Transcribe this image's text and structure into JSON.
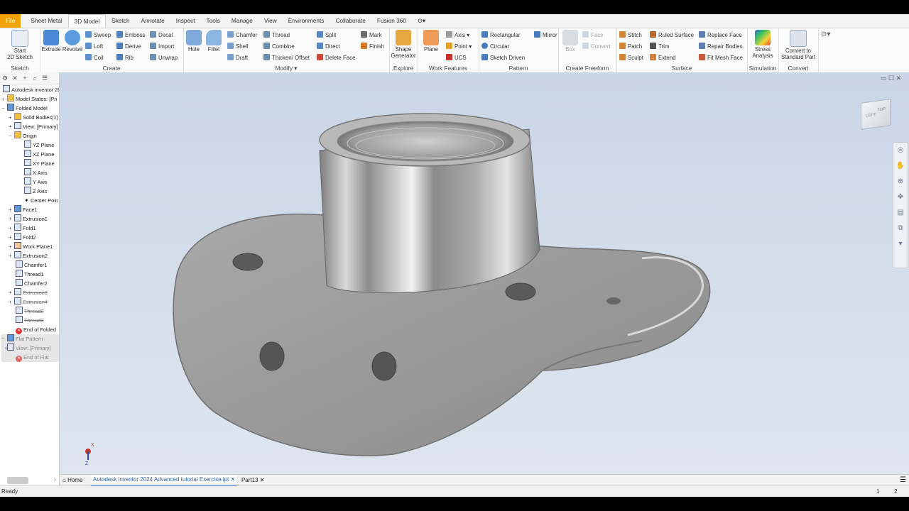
{
  "tabs": [
    "File",
    "Sheet Metal",
    "3D Model",
    "Sketch",
    "Annotate",
    "Inspect",
    "Tools",
    "Manage",
    "View",
    "Environments",
    "Collaborate",
    "Fusion 360"
  ],
  "ribbon": {
    "sketch": {
      "start_line1": "Start",
      "start_line2": "2D Sketch",
      "label": "Sketch"
    },
    "create": {
      "extrude": "Extrude",
      "revolve": "Revolve",
      "sweep": "Sweep",
      "loft": "Loft",
      "coil": "Coil",
      "emboss": "Emboss",
      "derive": "Derive",
      "rib": "Rib",
      "decal": "Decal",
      "import": "Import",
      "unwrap": "Unwrap",
      "label": "Create"
    },
    "modify": {
      "hole": "Hole",
      "fillet": "Fillet",
      "chamfer": "Chamfer",
      "shell": "Shell",
      "draft": "Draft",
      "thread": "Thread",
      "combine": "Combine",
      "thicken": "Thicken/ Offset",
      "split": "Split",
      "direct": "Direct",
      "delete_face": "Delete Face",
      "mark": "Mark",
      "finish": "Finish",
      "label": "Modify"
    },
    "explore": {
      "shape1": "Shape",
      "shape2": "Generator",
      "label": "Explore"
    },
    "work": {
      "plane": "Plane",
      "axis": "Axis",
      "point": "Point",
      "ucs": "UCS",
      "label": "Work Features"
    },
    "pattern": {
      "rectangular": "Rectangular",
      "circular": "Circular",
      "sketch_driven": "Sketch Driven",
      "mirror": "Mirror",
      "label": "Pattern"
    },
    "freeform": {
      "box": "Box",
      "face": "Face",
      "convert": "Convert",
      "label": "Create Freeform"
    },
    "surface": {
      "stitch": "Stitch",
      "patch": "Patch",
      "sculpt": "Sculpt",
      "ruled": "Ruled Surface",
      "trim": "Trim",
      "extend": "Extend",
      "replace": "Replace Face",
      "repair": "Repair Bodies",
      "fitmesh": "Fit Mesh Face",
      "label": "Surface"
    },
    "simulation": {
      "stress1": "Stress",
      "stress2": "Analysis",
      "label": "Simulation"
    },
    "convert": {
      "c1": "Convert to",
      "c2": "Standard Part",
      "label": "Convert"
    }
  },
  "browser": {
    "root": "Autodesk inventor 20",
    "model_states": "Model States: [Pri",
    "folded": "Folded Model",
    "solid_bodies": "Solid Bodies(1)",
    "view_primary": "View: [Primary]",
    "origin": "Origin",
    "yz": "YZ Plane",
    "xz": "XZ Plane",
    "xy": "XY Plane",
    "x_axis": "X Axis",
    "y_axis": "Y Axis",
    "z_axis": "Z Axis",
    "center": "Center Poin",
    "face1": "Face1",
    "extrusion1": "Extrusion1",
    "fold1": "Fold1",
    "fold2": "Fold2",
    "workplane1": "Work Plane1",
    "extrusion2": "Extrusion2",
    "chamfer1": "Chamfer1",
    "thread1": "Thread1",
    "chamfer2": "Chamfer2",
    "extrusion3": "Extrusion3",
    "extrusion4": "Extrusion4",
    "thread2": "Thread2",
    "thread3": "Thread3",
    "end_folded": "End of Folded",
    "flat_pattern": "Flat Pattern",
    "flat_view": "View: [Primary]",
    "end_flat": "End of Flat"
  },
  "viewcube": {
    "left": "LEFT",
    "top": "TOP"
  },
  "triad": {
    "x": "X",
    "z": "Z"
  },
  "doc_tabs": {
    "home": "Home",
    "doc1": "Autodesk inventor 2024 Advanced tutorial Exercise.ipt",
    "doc2": "Part13"
  },
  "status": {
    "text": "Ready",
    "n1": "1",
    "n2": "2"
  },
  "colors": {
    "file_tab": "#f5a300",
    "viewport_top": "#c9d6e6",
    "viewport_bottom": "#dee5ee",
    "part": "#9b9b9b"
  }
}
